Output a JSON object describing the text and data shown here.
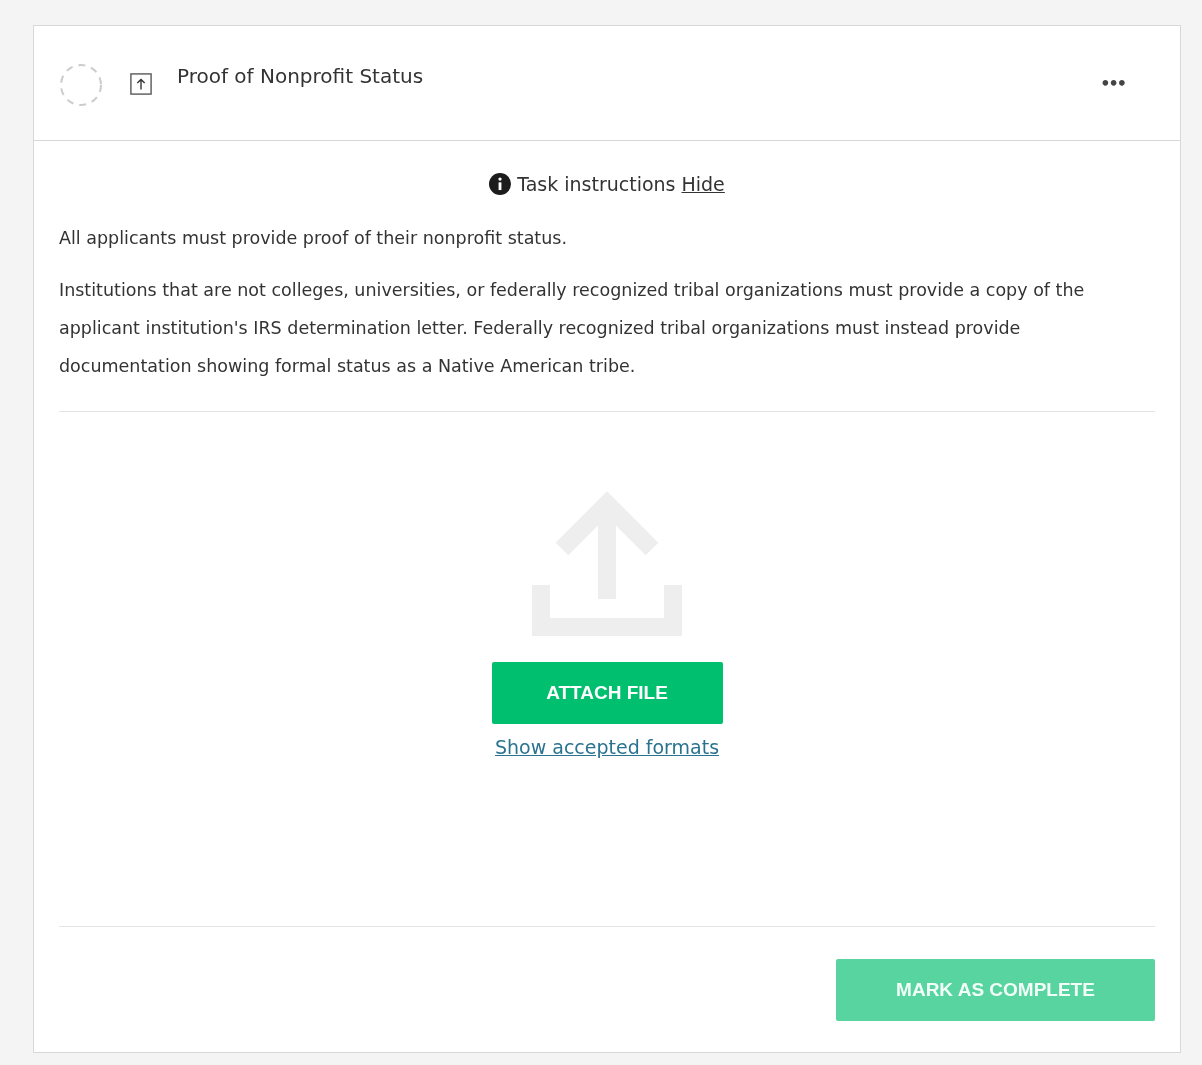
{
  "task": {
    "title": "Proof of Nonprofit Status",
    "completed": false,
    "menu_label": "•••"
  },
  "instructions": {
    "label": "Task instructions",
    "toggle": "Hide",
    "paragraphs": [
      "All applicants must provide proof of their nonprofit status.",
      "Institutions that are not colleges, universities, or federally recognized tribal organizations must provide a copy of the applicant institution's IRS determination letter. Federally recognized tribal organizations must instead provide documentation showing formal status as a Native American tribe."
    ]
  },
  "upload": {
    "button": "ATTACH FILE",
    "formats_link": "Show accepted formats"
  },
  "footer": {
    "button": "MARK AS COMPLETE",
    "disabled": true
  }
}
